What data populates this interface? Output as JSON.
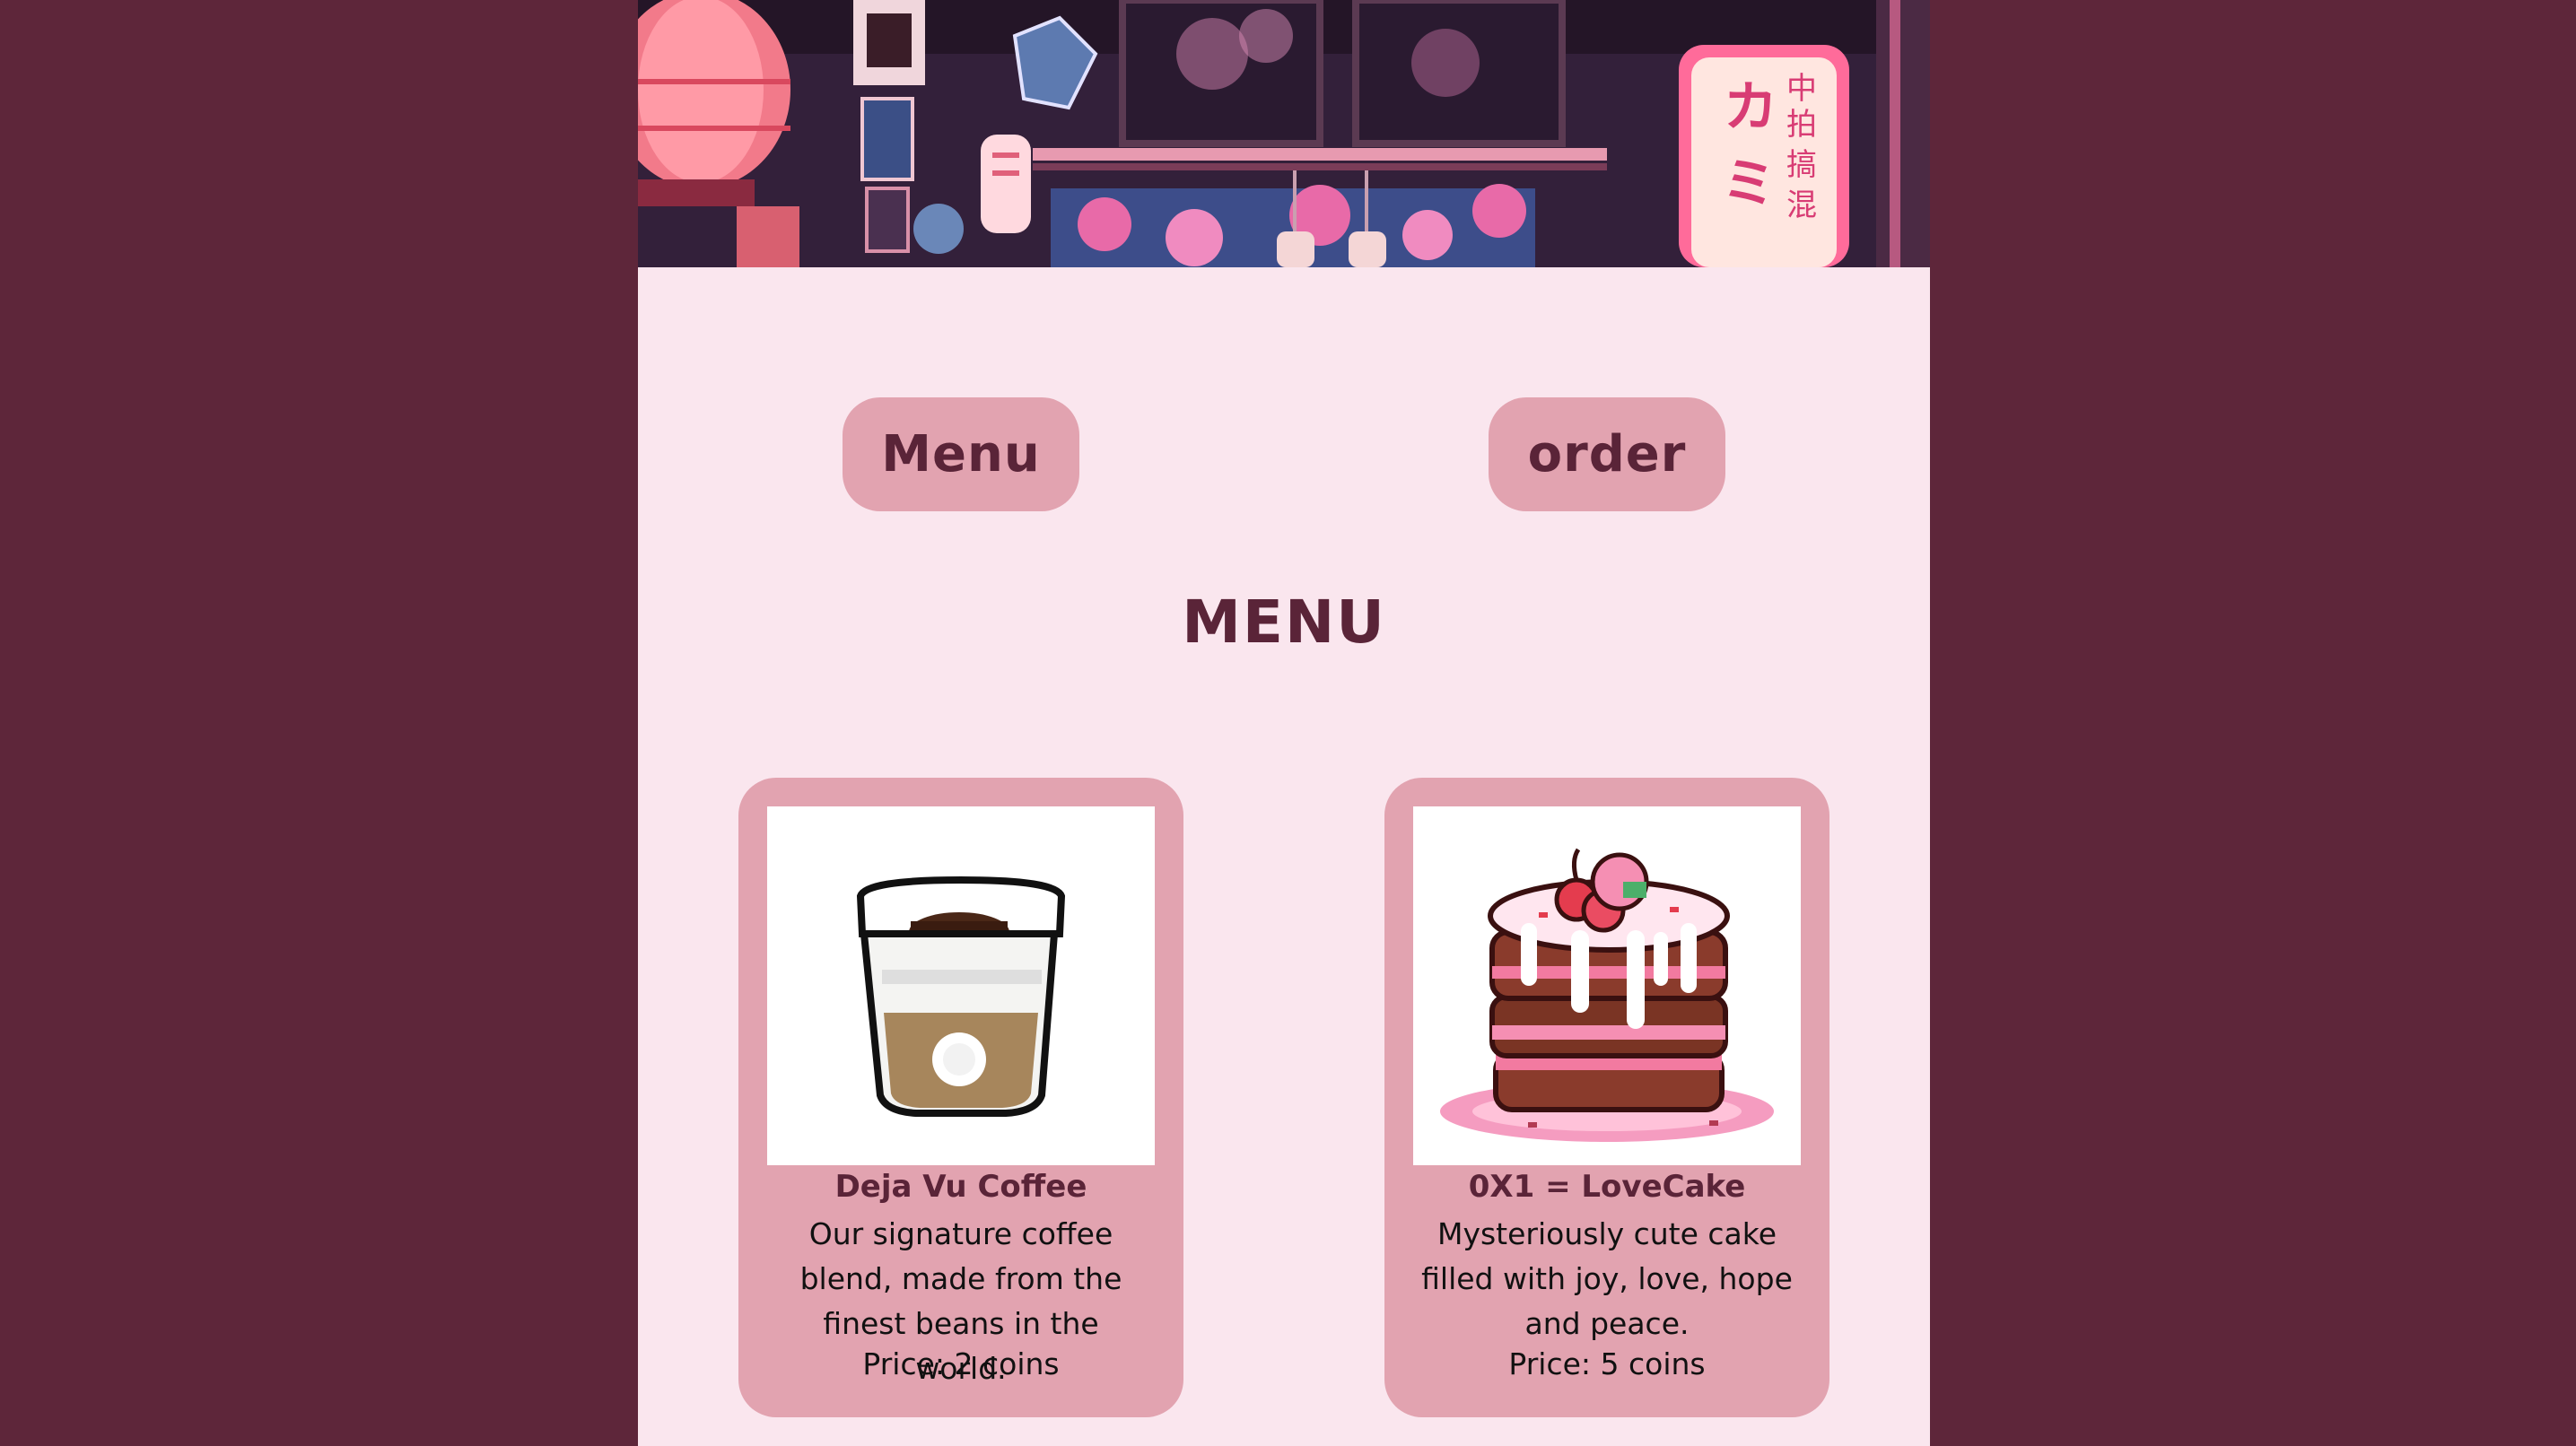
{
  "banner": {
    "icon": "pixel-art-shop-front",
    "colors": {
      "lantern": "#f27a8a",
      "sign": "#ffd9df",
      "blossom": "#e86aa8"
    }
  },
  "nav": {
    "menu_label": "Menu",
    "order_label": "order"
  },
  "page": {
    "title": "MENU"
  },
  "theme": {
    "background": "#5e263a",
    "panel": "#fae6ee",
    "accent": "#e2a3b0",
    "text_dark": "#5a2438"
  },
  "menu_items": [
    {
      "name": "Deja Vu Coffee",
      "description": "Our signature coffee blend, made from the finest beans in the world.",
      "price": "Price: 2 coins",
      "icon": "coffee-cup-icon"
    },
    {
      "name": "0X1 = LoveCake",
      "description": "Mysteriously cute cake filled with joy, love, hope and peace.",
      "price": "Price: 5 coins",
      "icon": "cake-icon"
    }
  ]
}
